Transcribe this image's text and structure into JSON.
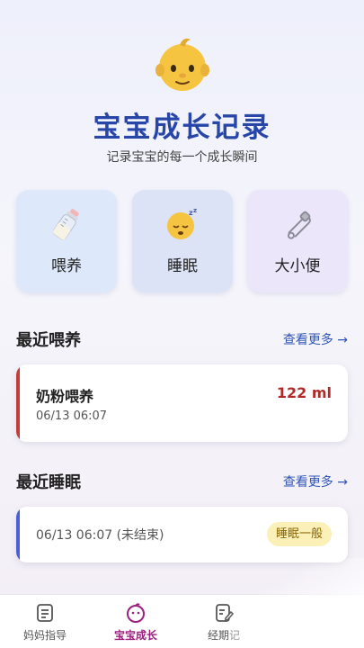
{
  "header": {
    "emoji_icon": "baby-face-icon",
    "title": "宝宝成长记录",
    "subtitle": "记录宝宝的每一个成长瞬间"
  },
  "quick_actions": [
    {
      "label": "喂养",
      "icon": "baby-bottle-icon"
    },
    {
      "label": "睡眠",
      "icon": "sleeping-face-icon"
    },
    {
      "label": "大小便",
      "icon": "safety-pin-icon"
    }
  ],
  "recent_feeding": {
    "title": "最近喂养",
    "more": "查看更多 →",
    "record": {
      "name": "奶粉喂养",
      "amount": "122 ml",
      "time": "06/13 06:07"
    },
    "accent": "#c43c3c"
  },
  "recent_sleep": {
    "title": "最近睡眠",
    "more": "查看更多 →",
    "record": {
      "time": "06/13 06:07 (未结束)",
      "quality": "睡眠一般"
    },
    "accent": "#4d5fd6"
  },
  "tabbar": {
    "tabs": [
      {
        "label": "妈妈指导",
        "icon": "guide-list-icon",
        "active": false
      },
      {
        "label": "宝宝成长",
        "icon": "baby-smile-icon",
        "active": true
      },
      {
        "label": "经期记",
        "icon": "edit-note-icon",
        "active": false
      }
    ],
    "active_color": "#9a1f7e"
  }
}
